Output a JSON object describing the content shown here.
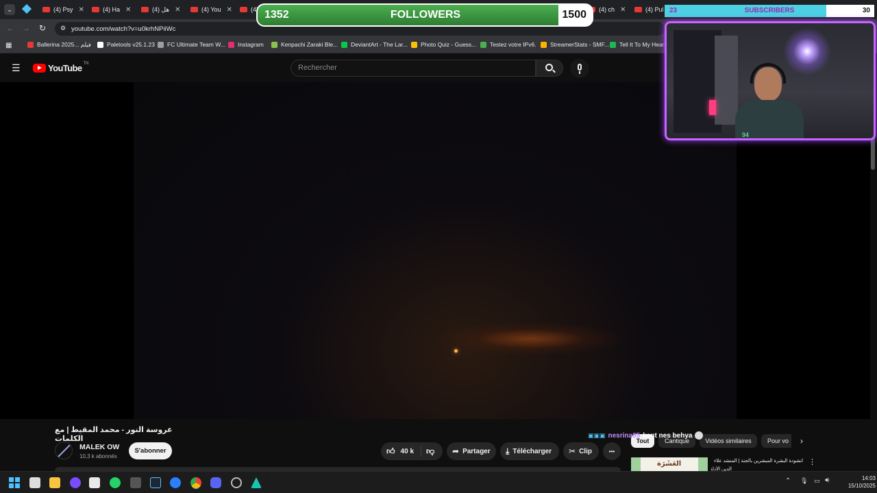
{
  "browser": {
    "tabs": [
      {
        "label": "(4) Psy",
        "type": "youtube"
      },
      {
        "label": "(4) Ha",
        "type": "youtube"
      },
      {
        "label": "(4) هل",
        "type": "youtube"
      },
      {
        "label": "(4) You",
        "type": "youtube"
      },
      {
        "label": "(4)",
        "type": "youtube"
      },
      {
        "label": "(4) ch",
        "type": "youtube"
      },
      {
        "label": "(4) Pul",
        "type": "youtube"
      }
    ],
    "url": "youtube.com/watch?v=u0krhNPiiWc",
    "bookmarks": [
      {
        "label": "Ballerina 2025... فيلم",
        "color": "#e53935"
      },
      {
        "label": "Paletools v25.1.23",
        "color": "#ffffff"
      },
      {
        "label": "FC Ultimate Team W...",
        "color": "#9e9e9e"
      },
      {
        "label": "Instagram",
        "color": "#e1306c"
      },
      {
        "label": "Kenpachi Zaraki Ble...",
        "color": "#8bc34a"
      },
      {
        "label": "DeviantArt - The Lar...",
        "color": "#05cc47"
      },
      {
        "label": "Photo Quiz - Guess...",
        "color": "#ffc107"
      },
      {
        "label": "Testez votre IPv6.",
        "color": "#4caf50"
      },
      {
        "label": "StreamerStats - SMF...",
        "color": "#ffb300"
      },
      {
        "label": "Tell It To My Heart",
        "color": "#1db954"
      }
    ]
  },
  "youtube": {
    "logo_text": "YouTube",
    "logo_suffix": "TN",
    "search_placeholder": "Rechercher",
    "video_title": "عروسة النور - محمد المقيط | مع الكلمات",
    "channel_name": "MALEK OW",
    "channel_subs": "10,3 k abonnés",
    "subscribe_label": "S'abonner",
    "like_count": "40 k",
    "share_label": "Partager",
    "download_label": "Télécharger",
    "clip_label": "Clip",
    "more_label": "•••",
    "filter_chips": [
      "Tout",
      "Cantique",
      "Vidéos similaires",
      "Pour vo"
    ],
    "recommended_title": "انشودة البشرة المبشرين بالجنة | المنشد علاء",
    "recommended_subtitle": "الدين الأدلقي",
    "recommended_thumb_text": "العَشَرَة"
  },
  "overlay": {
    "followers_current": "1352",
    "followers_label": "FOLLOWERS",
    "followers_goal": "1500",
    "followers_progress": 0.9,
    "subs_current": "23",
    "subs_label": "SUBSCRIBERS",
    "subs_goal": "30",
    "subs_progress": 0.77,
    "chat_user": "nesrina65",
    "chat_message": "kent nes behya",
    "webcam_caption": "94"
  },
  "taskbar": {
    "time": "14:03",
    "date": "15/10/2025"
  },
  "colors": {
    "youtube_red": "#ff0000",
    "followers_green": "#4caf50",
    "subs_cyan": "#4dd0e1",
    "webcam_border": "#c864ff"
  }
}
